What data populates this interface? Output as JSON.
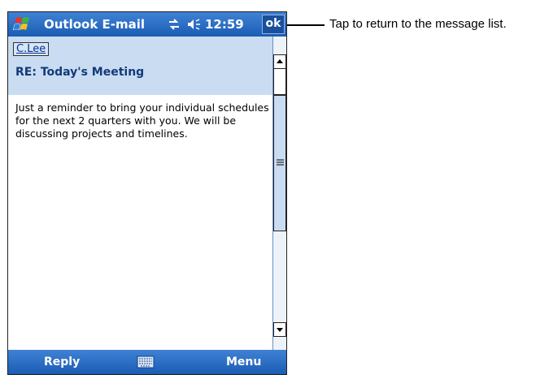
{
  "titlebar": {
    "app_title": "Outlook E-mail",
    "time": "12:59",
    "ok_label": "ok",
    "icons": [
      "start-flag-icon",
      "connectivity-icon",
      "volume-icon"
    ]
  },
  "message": {
    "sender": "C.Lee",
    "subject": "RE: Today's Meeting",
    "body": "Just a reminder to bring your individual schedules for the next 2 quarters with you. We will be discussing projects and timelines."
  },
  "menubar": {
    "reply_label": "Reply",
    "menu_label": "Menu",
    "icons": [
      "keyboard-icon"
    ]
  },
  "callout": {
    "text": "Tap to return to the message list."
  },
  "colors": {
    "titlebar": "#1b5cb4",
    "header_bg": "#c9dcf1",
    "subject": "#123a7a"
  }
}
